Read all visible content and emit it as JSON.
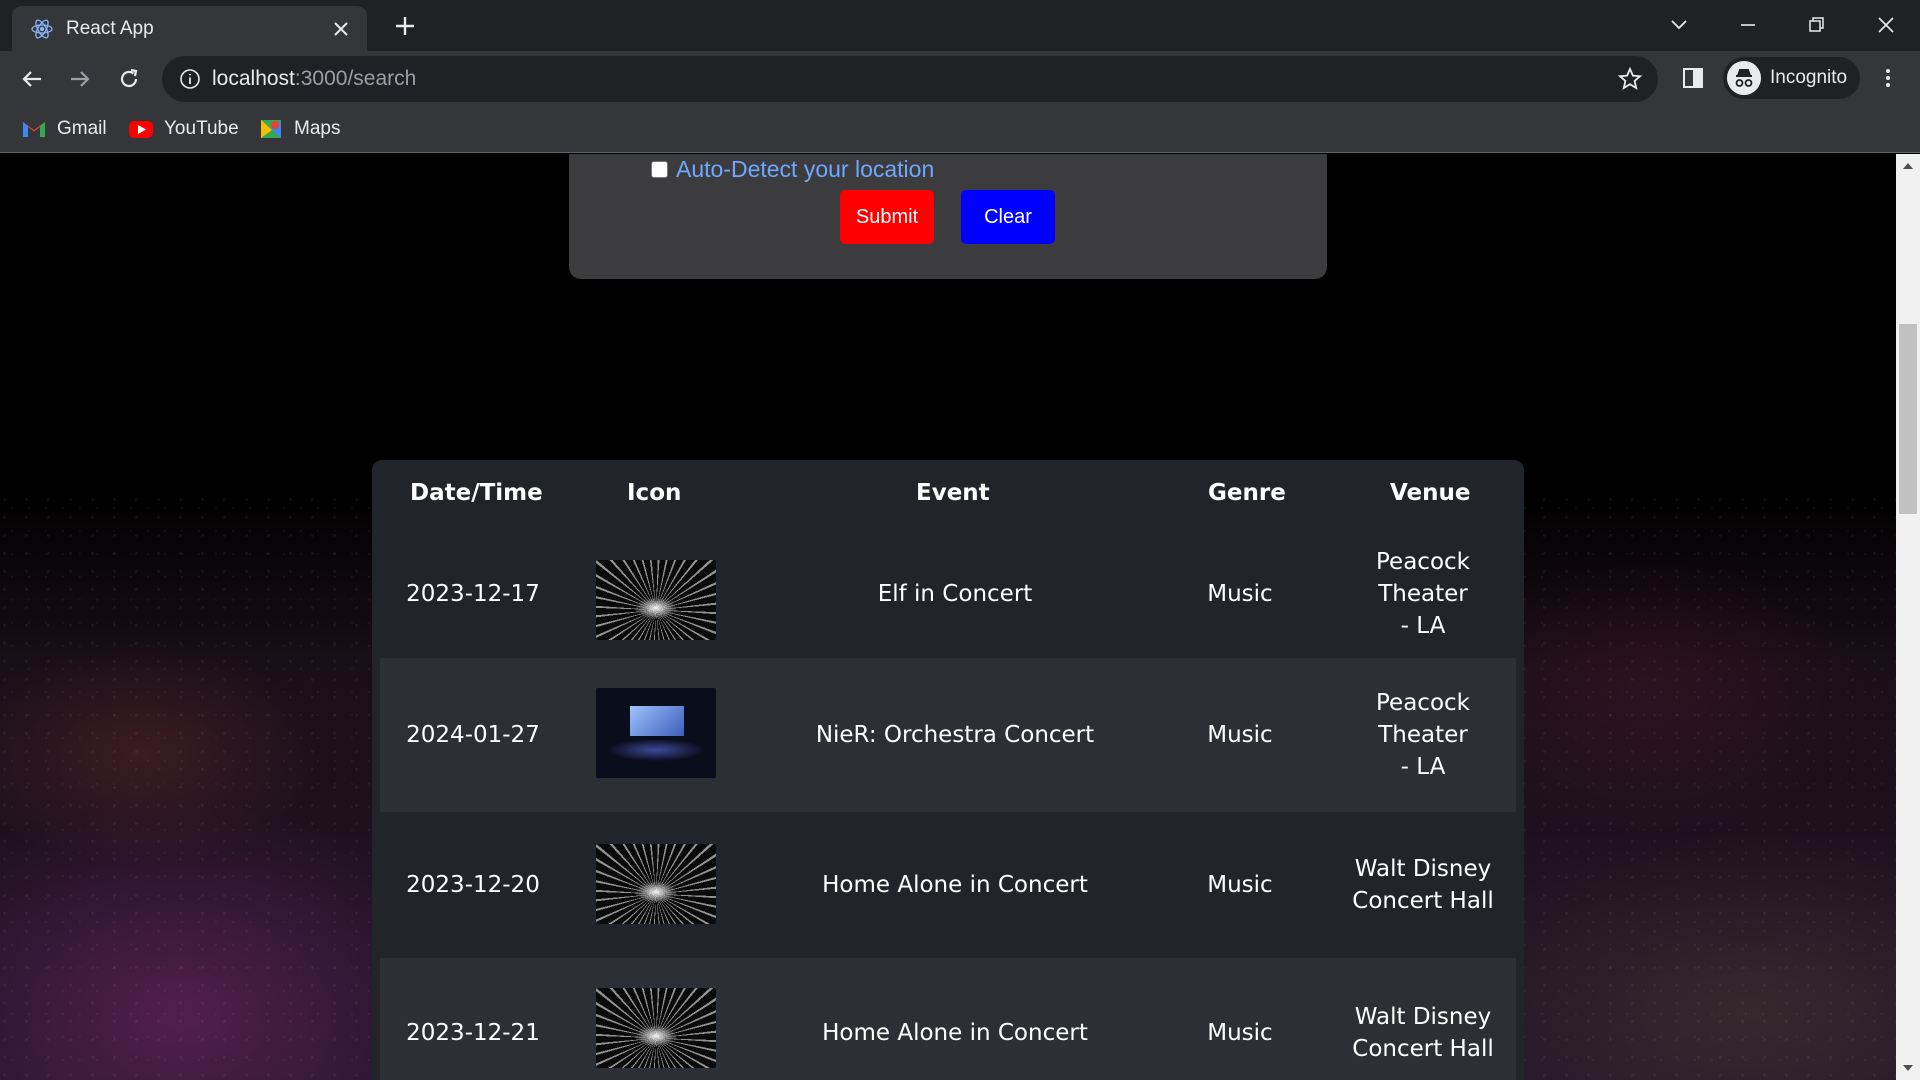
{
  "browser": {
    "tab_title": "React App",
    "url_host": "localhost",
    "url_path": ":3000/search",
    "profile_label": "Incognito",
    "bookmarks": [
      {
        "label": "Gmail",
        "icon": "gmail-icon"
      },
      {
        "label": "YouTube",
        "icon": "youtube-icon"
      },
      {
        "label": "Maps",
        "icon": "maps-icon"
      }
    ]
  },
  "form": {
    "autodetect_label": "Auto-Detect your location",
    "autodetect_checked": false,
    "submit_label": "Submit",
    "clear_label": "Clear",
    "submit_color": "#ff0000",
    "clear_color": "#0000ff"
  },
  "results": {
    "headers": {
      "datetime": "Date/Time",
      "icon": "Icon",
      "event": "Event",
      "genre": "Genre",
      "venue": "Venue"
    },
    "rows": [
      {
        "date": "2023-12-17",
        "thumb": "concert-stage-image",
        "event": "Elf in Concert",
        "genre": "Music",
        "venue_line1": "Peacock Theater",
        "venue_line2": "- LA"
      },
      {
        "date": "2024-01-27",
        "thumb": "orchestra-screen-image",
        "event": "NieR: Orchestra Concert",
        "genre": "Music",
        "venue_line1": "Peacock Theater",
        "venue_line2": "- LA"
      },
      {
        "date": "2023-12-20",
        "thumb": "concert-stage-image",
        "event": "Home Alone in Concert",
        "genre": "Music",
        "venue_line1": "Walt Disney",
        "venue_line2": "Concert Hall"
      },
      {
        "date": "2023-12-21",
        "thumb": "concert-stage-image",
        "event": "Home Alone in Concert",
        "genre": "Music",
        "venue_line1": "Walt Disney",
        "venue_line2": "Concert Hall"
      }
    ]
  }
}
